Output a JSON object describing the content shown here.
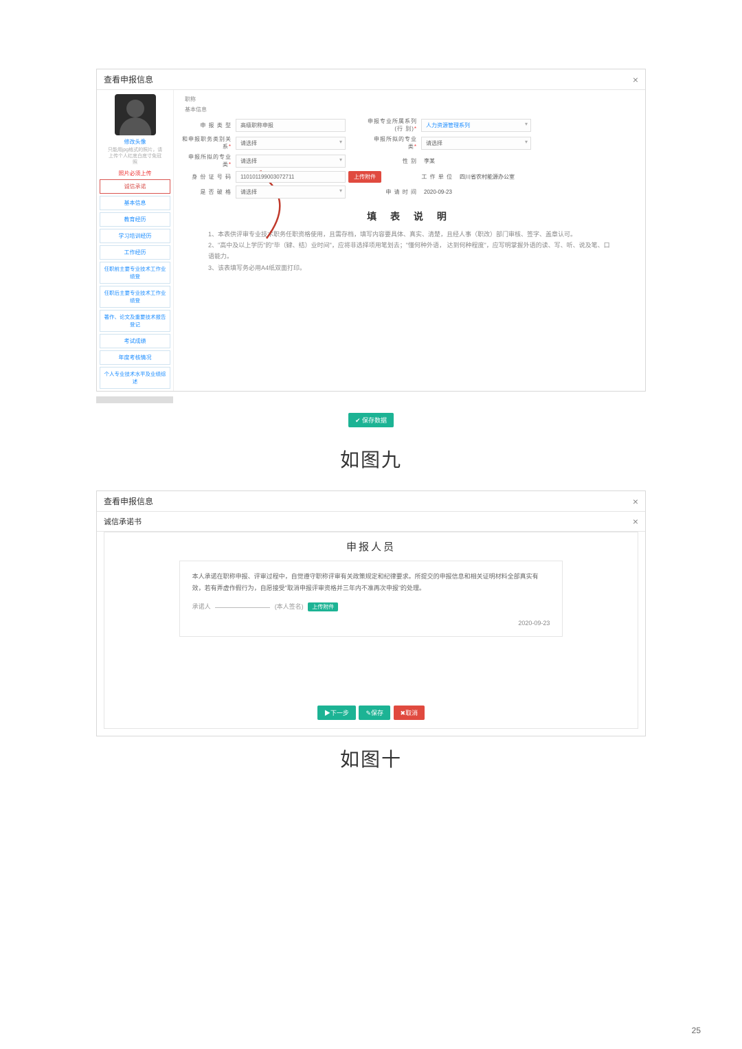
{
  "page_number": "25",
  "caption1": "如图九",
  "caption2": "如图十",
  "modal1": {
    "title": "查看申报信息",
    "close": "×",
    "sidebar": {
      "change_avatar": "修改头像",
      "avatar_note": "只能用jpg格式的照片，请上传个人红底白底寸免冠照",
      "must_upload": "照片必须上传",
      "items": [
        "诚信承诺",
        "基本信息",
        "教育经历",
        "学习培训经历",
        "工作经历",
        "任职前主要专业技术工作业绩登",
        "任职后主要专业技术工作业绩登",
        "著作、论文及重要技术报告登记",
        "考试成绩",
        "年度考核情况",
        "个人专业技术水平及业绩综述"
      ]
    },
    "tabs": {
      "t1": "职称",
      "t2": "基本信息"
    },
    "form": {
      "type_label": "申 报 类 型",
      "type_value": "高级职称申报",
      "series_old_label": "申报专业所属系列(行   别)",
      "series_old_value": "人力资源管理系列",
      "level_rel_label": "和申报职务类别关   系",
      "level_rel_value": "请选择",
      "major_label": "申报所拟的专业   类",
      "major_value": "请选择",
      "level_label": "申报所拟的专业   类",
      "level_value": "请选择",
      "sex_label": "性   别",
      "sex_value": "李某",
      "id_label": "身 份 证 号 码",
      "id_value": "110101199003072711",
      "upload": "上传附件",
      "unit_label": "工 作 单 位",
      "unit_value": "四川省农村能源办公室",
      "award_label": "是 否 破 格",
      "award_value": "请选择",
      "date_label": "申 请 时 间",
      "date_value": "2020-09-23"
    },
    "instructions": {
      "title": "填 表 说 明",
      "line1": "1、本表供评审专业技术职务任职资格使用，且需存档，填写内容要具体、真实、清楚，且经人事（职改）部门审核、签字、盖章认可。",
      "line2": "2、\"高中及以上学历\"的\"毕（肄、结）业时间\"，应将非选择项用笔划去；\"懂何种外语， 达到何种程度\"，应写明掌握外语的读、写、听、说及笔、口语能力。",
      "line3": "3、该表填写务必用A4纸双面打印。"
    },
    "save_btn": "保存数据"
  },
  "modal2": {
    "title": "查看申报信息",
    "inner_title": "诚信承诺书",
    "close": "×",
    "pledge_title": "申报人员",
    "pledge_body": "本人承诺在职称申报、评审过程中，自觉遵守职称评审有关政策规定和纪律要求。所提交的申报信息和相关证明材料全部真实有效，若有弄虚作假行为，自愿接受\"取消申报评审资格并三年内不准再次申报\"的处理。",
    "sign_prefix": "承诺人",
    "sign_suffix": "(本人签名)",
    "upload": "上传附件",
    "date": "2020-09-23",
    "btn_next": "下一步",
    "btn_save": "保存",
    "btn_cancel": "取消",
    "icon_next": "▶",
    "icon_save": "✎",
    "icon_cancel": "✖"
  }
}
